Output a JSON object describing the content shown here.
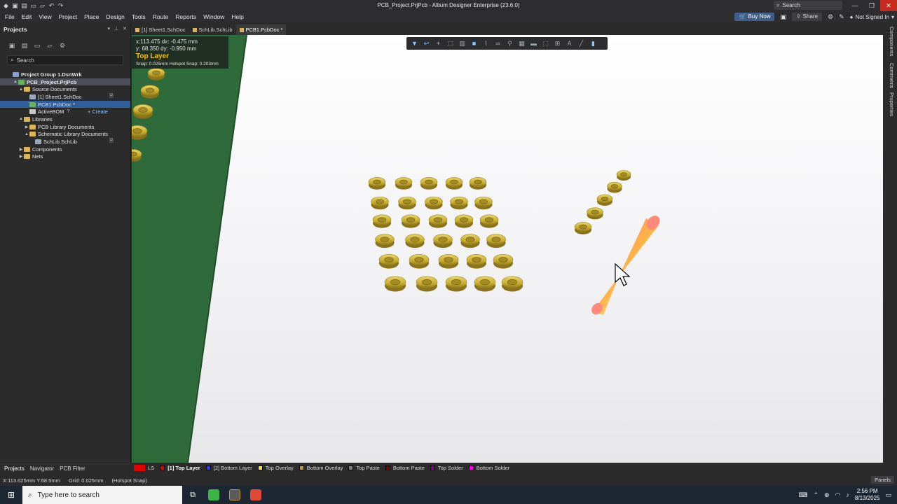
{
  "window": {
    "title": "PCB_Project.PrjPcb - Altium Designer Enterprise (23.6.0)",
    "search_label": "Search"
  },
  "menu": {
    "items": [
      "File",
      "Edit",
      "View",
      "Project",
      "Place",
      "Design",
      "Tools",
      "Route",
      "Reports",
      "Window",
      "Help"
    ],
    "buy_now": "Buy Now",
    "share": "Share",
    "user": "Not Signed In"
  },
  "projects_panel": {
    "title": "Projects",
    "search_placeholder": "Search",
    "tree": [
      {
        "label": "Project Group 1.DsnWrk",
        "indent": 0,
        "twisty": "",
        "icon": "grp",
        "bold": true
      },
      {
        "label": "PCB_Project.PrjPcb",
        "indent": 1,
        "twisty": "▲",
        "icon": "pcb",
        "bold": true,
        "state": "hl"
      },
      {
        "label": "Source Documents",
        "indent": 2,
        "twisty": "▲",
        "icon": "folder"
      },
      {
        "label": "[1] Sheet1.SchDoc",
        "indent": 3,
        "twisty": "",
        "icon": "doc",
        "indicator": "🗎"
      },
      {
        "label": "PCB1.PcbDoc *",
        "indent": 3,
        "twisty": "",
        "icon": "pcb",
        "state": "sel"
      },
      {
        "label": "ActiveBOM",
        "indent": 3,
        "twisty": "",
        "icon": "bom",
        "help": "?",
        "create": "+ Create"
      },
      {
        "label": "Libraries",
        "indent": 2,
        "twisty": "▲",
        "icon": "folder"
      },
      {
        "label": "PCB Library Documents",
        "indent": 3,
        "twisty": "▶",
        "icon": "folder"
      },
      {
        "label": "Schematic Library Documents",
        "indent": 3,
        "twisty": "▲",
        "icon": "folder"
      },
      {
        "label": "SchLib.SchLib",
        "indent": 4,
        "twisty": "",
        "icon": "doc",
        "indicator": "🗎"
      },
      {
        "label": "Components",
        "indent": 2,
        "twisty": "▶",
        "icon": "folder"
      },
      {
        "label": "Nets",
        "indent": 2,
        "twisty": "▶",
        "icon": "folder"
      }
    ],
    "bottom_tabs": [
      "Projects",
      "Navigator",
      "PCB Filter"
    ]
  },
  "doc_tabs": [
    {
      "label": "[1] Sheet1.SchDoc",
      "active": false
    },
    {
      "label": "SchLib.SchLib",
      "active": false
    },
    {
      "label": "PCB1.PcbDoc *",
      "active": true
    }
  ],
  "hud": {
    "line1": "x:113.475   dx: -0.475  mm",
    "line2": "y: 68.350   dy: -0.950  mm",
    "layer": "Top Layer",
    "snap": "Snap: 0.025mm Hotspot Snap: 0.203mm"
  },
  "right_dock": [
    "Components",
    "Comments",
    "Properties"
  ],
  "layers": {
    "ls_label": "LS",
    "items": [
      {
        "label": "[1] Top Layer",
        "color": "#e00000",
        "active": true
      },
      {
        "label": "[2] Bottom Layer",
        "color": "#2040ff",
        "active": false
      },
      {
        "label": "Top Overlay",
        "color": "#f5e642",
        "active": false
      },
      {
        "label": "Bottom Overlay",
        "color": "#b0a040",
        "active": false
      },
      {
        "label": "Top Paste",
        "color": "#808080",
        "active": false
      },
      {
        "label": "Bottom Paste",
        "color": "#800000",
        "active": false
      },
      {
        "label": "Top Solder",
        "color": "#800080",
        "active": false
      },
      {
        "label": "Bottom Solder",
        "color": "#ff00ff",
        "active": false
      }
    ]
  },
  "status": {
    "coords": "X:113.025mm Y:68.5mm",
    "grid": "Grid: 0.025mm",
    "snap": "(Hotspot Snap)",
    "panels": "Panels"
  },
  "taskbar": {
    "search_placeholder": "Type here to search",
    "time": "2:56 PM",
    "date": "8/13/2025"
  },
  "colors": {
    "board_green": "#2f6b3a",
    "pad_gold": "#c9b23a",
    "accent": "#2f5f9a"
  }
}
